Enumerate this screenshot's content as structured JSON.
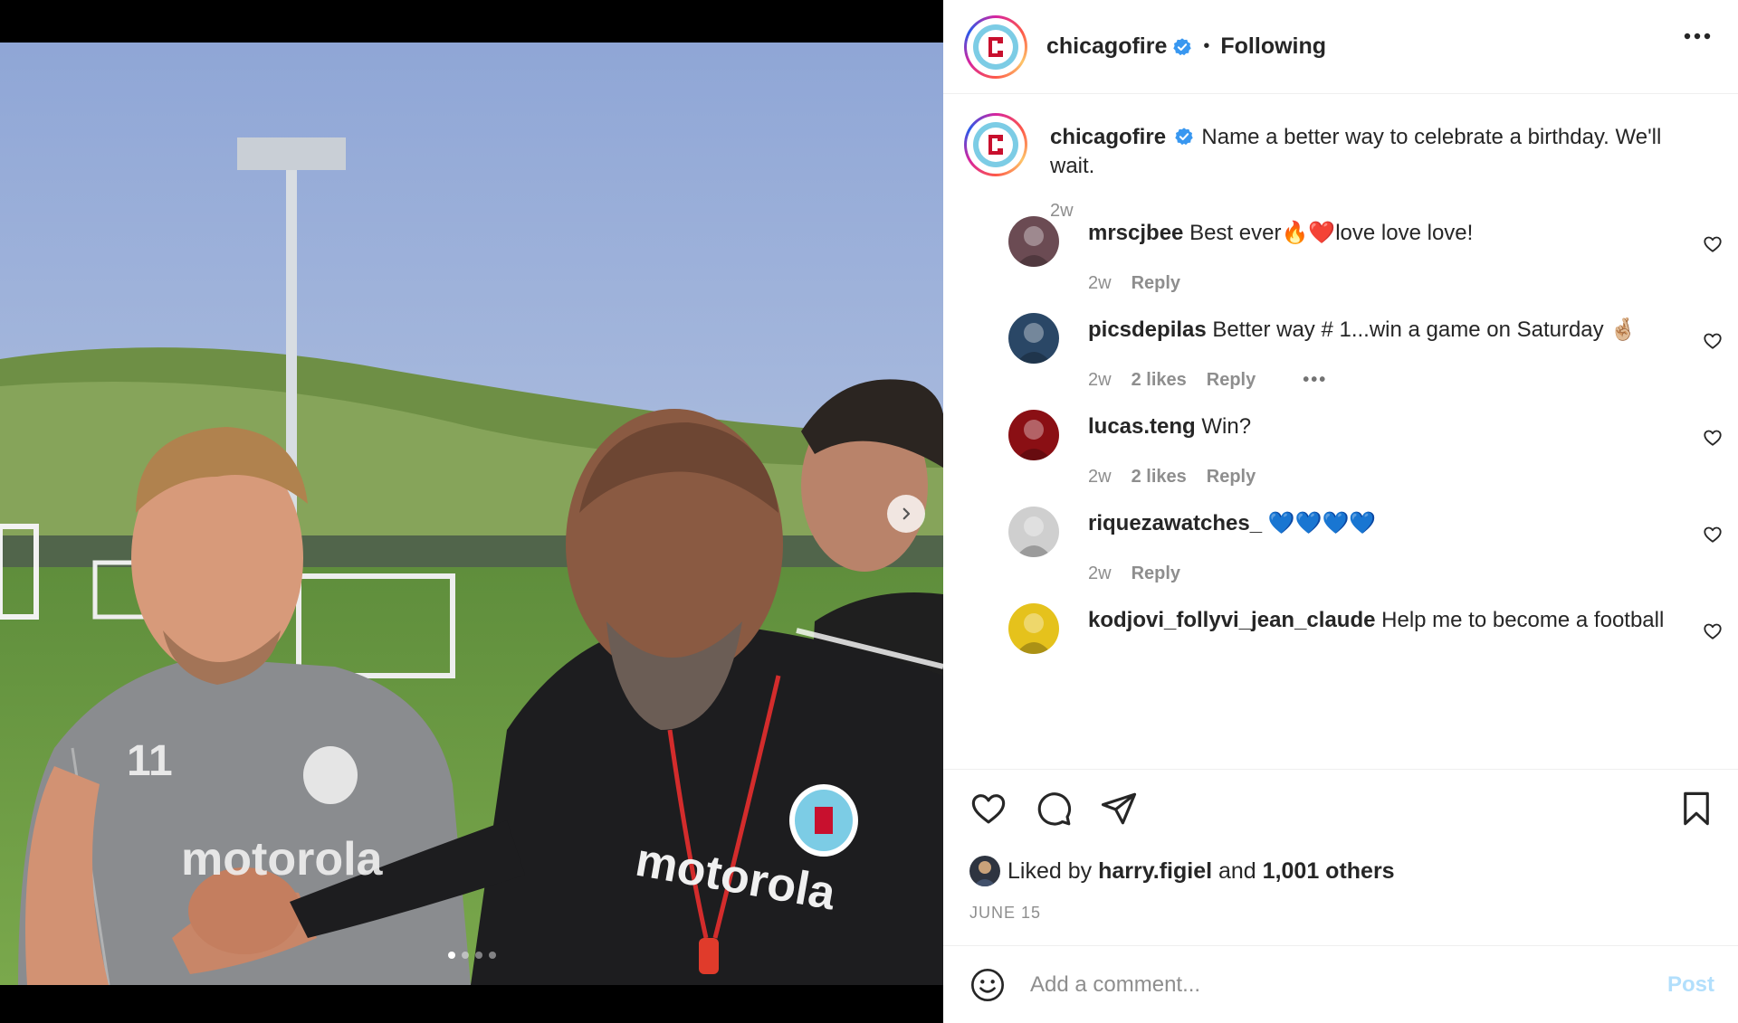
{
  "post": {
    "username": "chicagofire",
    "follow_status": "Following",
    "separator": "•",
    "caption": "Name a better way to celebrate a birthday. We'll wait.",
    "caption_time": "2w",
    "carousel_count": 4,
    "carousel_active_index": 0
  },
  "comments": [
    {
      "username": "mrscjbee",
      "text": "Best ever🔥❤️love love love!",
      "time": "2w",
      "likes": "",
      "reply": "Reply",
      "avatar_color": "#6b4b53"
    },
    {
      "username": "picsdepilas",
      "text": "Better way # 1...win a game on Saturday 🤞🏼",
      "time": "2w",
      "likes": "2 likes",
      "reply": "Reply",
      "more": "•••",
      "avatar_color": "#2a4766"
    },
    {
      "username": "lucas.teng",
      "text": "Win?",
      "time": "2w",
      "likes": "2 likes",
      "reply": "Reply",
      "avatar_color": "#8a0f14"
    },
    {
      "username": "riquezawatches_",
      "text": "💙💙💙💙",
      "time": "2w",
      "likes": "",
      "reply": "Reply",
      "avatar_color": "#cfcfcf"
    },
    {
      "username": "kodjovi_follyvi_jean_claude",
      "text": "Help me to become a football",
      "time": "",
      "likes": "",
      "reply": "",
      "avatar_color": "#e5c21c"
    }
  ],
  "engagement": {
    "liked_by_prefix": "Liked by",
    "liked_by_user": "harry.figiel",
    "and": "and",
    "others": "1,001 others",
    "date": "JUNE 15"
  },
  "add_comment": {
    "placeholder": "Add a comment...",
    "post_label": "Post"
  },
  "icons": {
    "more": "more-horizontal-icon",
    "verified": "verified-badge-icon",
    "like": "heart-icon",
    "comment": "comment-bubble-icon",
    "share": "paper-plane-icon",
    "save": "bookmark-icon",
    "emoji": "smiley-icon",
    "next": "chevron-right-icon"
  },
  "colors": {
    "text": "#262626",
    "secondary": "#8e8e8e",
    "verified": "#3897f0",
    "post_disabled": "#b2dffc",
    "brand_red": "#c8102e",
    "brand_blue": "#7ccce5"
  }
}
